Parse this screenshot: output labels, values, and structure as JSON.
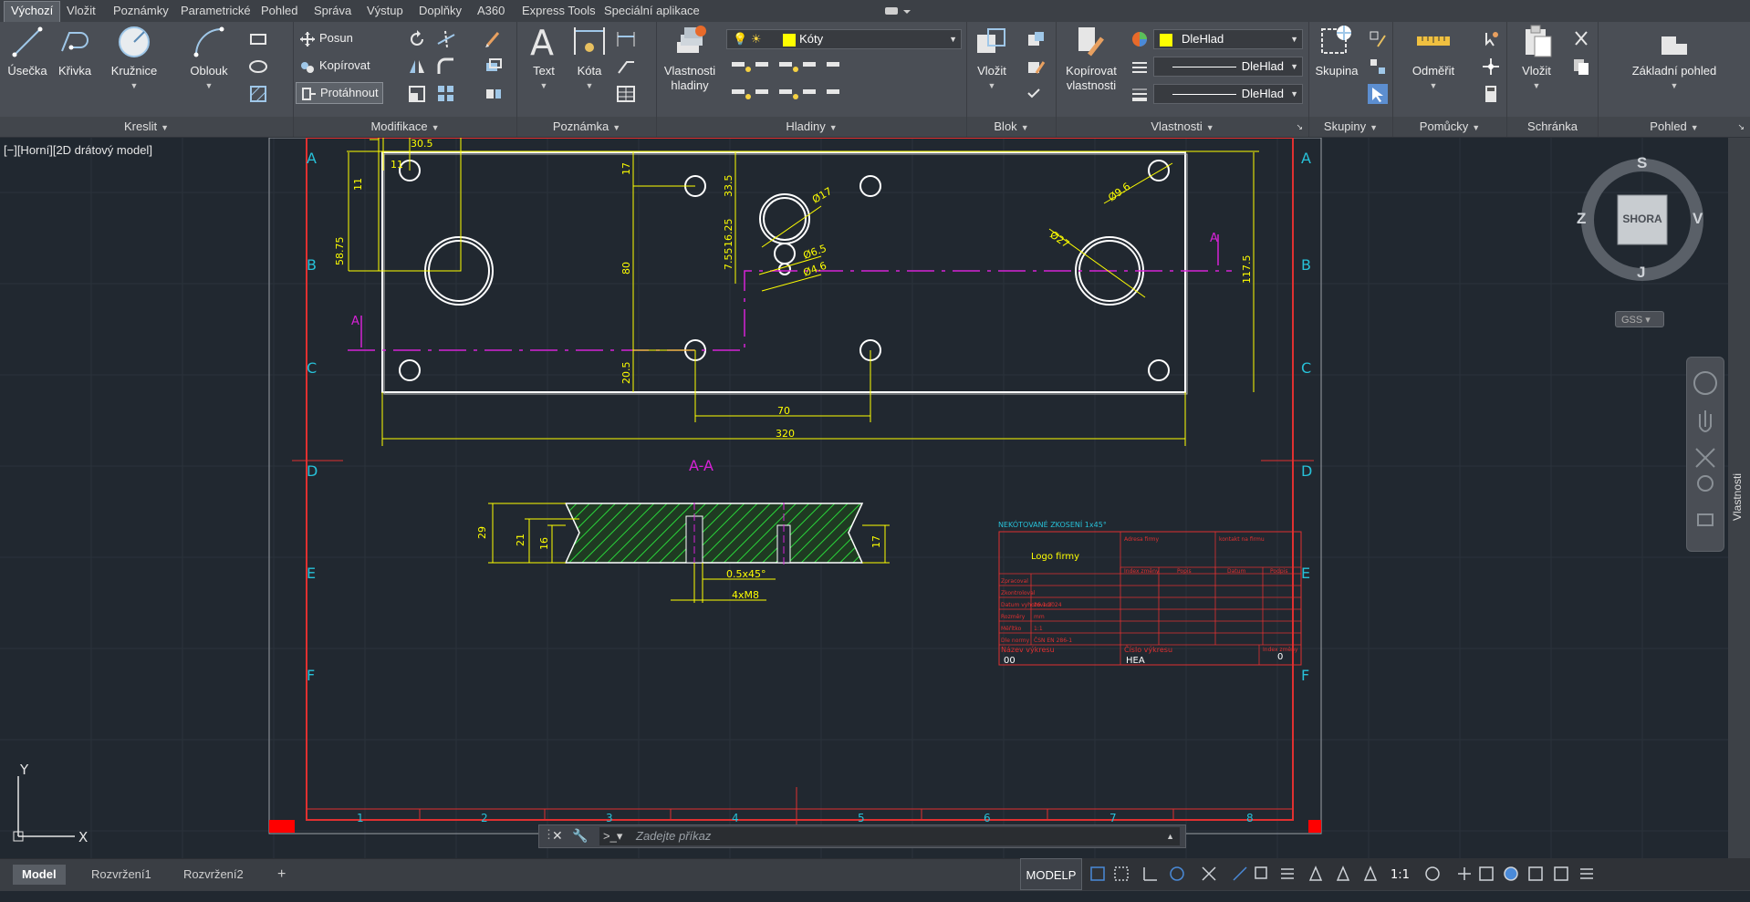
{
  "menu_tabs": [
    "Výchozí",
    "Vložit",
    "Poznámky",
    "Parametrické",
    "Pohled",
    "Správa",
    "Výstup",
    "Doplňky",
    "A360",
    "Express Tools",
    "Speciální aplikace"
  ],
  "ribbon": {
    "kreslit": {
      "title": "Kreslit",
      "usecka": "Úsečka",
      "krivka": "Křivka",
      "kruznice": "Kružnice",
      "oblouk": "Oblouk"
    },
    "modifikace": {
      "title": "Modifikace",
      "posun": "Posun",
      "kopirovat": "Kopírovat",
      "protahnout": "Protáhnout"
    },
    "poznamka": {
      "title": "Poznámka",
      "text": "Text",
      "kota": "Kóta"
    },
    "hladiny": {
      "title": "Hladiny",
      "vlastnosti_line1": "Vlastnosti",
      "vlastnosti_line2": "hladiny",
      "layer": "Kóty"
    },
    "blok": {
      "title": "Blok",
      "vlozit": "Vložit"
    },
    "vlastnosti": {
      "title": "Vlastnosti",
      "kop_line1": "Kopírovat",
      "kop_line2": "vlastnosti",
      "color": "DleHlad",
      "linetype": "DleHlad",
      "lineweight": "DleHlad"
    },
    "skupiny": {
      "title": "Skupiny",
      "skupina": "Skupina"
    },
    "pomucky": {
      "title": "Pomůcky",
      "odmerit": "Odměřit"
    },
    "schranka": {
      "title": "Schránka",
      "vlozit": "Vložit"
    },
    "pohled": {
      "title": "Pohled",
      "zakladni": "Základní pohled"
    }
  },
  "viewport_label": "[−][Horní][2D drátový model]",
  "viewcube": {
    "top": "SHORA",
    "n": "S",
    "s": "J",
    "w": "Z",
    "e": "V",
    "ucs": "GSS"
  },
  "right_panel_label": "Vlastnosti",
  "drawing": {
    "row_letters": [
      "A",
      "B",
      "C",
      "D",
      "E",
      "F"
    ],
    "col_numbers": [
      "1",
      "2",
      "3",
      "4",
      "5",
      "6",
      "7",
      "8"
    ],
    "dims": {
      "d30_5": "30.5",
      "d11a": "11",
      "d11b": "11",
      "d58_75": "58.75",
      "d17": "17",
      "d33_5": "33.5",
      "d80": "80",
      "d20_5": "20.5",
      "d16_25": "16.25",
      "d7_55": "7.55",
      "d70": "70",
      "d320": "320",
      "d117_5": "117.5",
      "phi17": "Ø17",
      "phi6_5": "Ø6.5",
      "phi4_6": "Ø4.6",
      "phi9_6": "Ø9.6",
      "phi27": "Ø27",
      "s29": "29",
      "s21": "21",
      "s16": "16",
      "s17": "17",
      "chamfer": "0.5x45°",
      "thread": "4xM8"
    },
    "section_mark": "A",
    "section_title": "A-A",
    "title_block": {
      "note": "NEKÓTOVANÉ ZKOSENÍ 1x45°",
      "logo": "Logo firmy",
      "address": "Adresa firmy",
      "contact": "kontakt na firmu",
      "hdr_index": "Index změny",
      "hdr_popis": "Popis",
      "hdr_datum": "Datum",
      "hdr_podpis": "Podpis",
      "rows": [
        {
          "k": "Zpracoval",
          "v": ""
        },
        {
          "k": "Zkontroloval",
          "v": ""
        },
        {
          "k": "Datum vyhotovení",
          "v": "26.1.2024"
        },
        {
          "k": "Rozměry",
          "v": "mm"
        },
        {
          "k": "Měřítko",
          "v": "1:1"
        },
        {
          "k": "Dle normy",
          "v": "ČSN EN 286-1"
        }
      ],
      "name_label": "Název výkresu",
      "name_value": "00",
      "number_label": "Číslo výkresu",
      "number_value": "HEA",
      "change_label": "Index změny",
      "change_value": "0"
    }
  },
  "ucs": {
    "x": "X",
    "y": "Y"
  },
  "command_placeholder": "Zadejte příkaz",
  "layout_tabs": [
    "Model",
    "Rozvržení1",
    "Rozvržení2"
  ],
  "status": {
    "mode": "MODELP",
    "scale": "1:1"
  }
}
